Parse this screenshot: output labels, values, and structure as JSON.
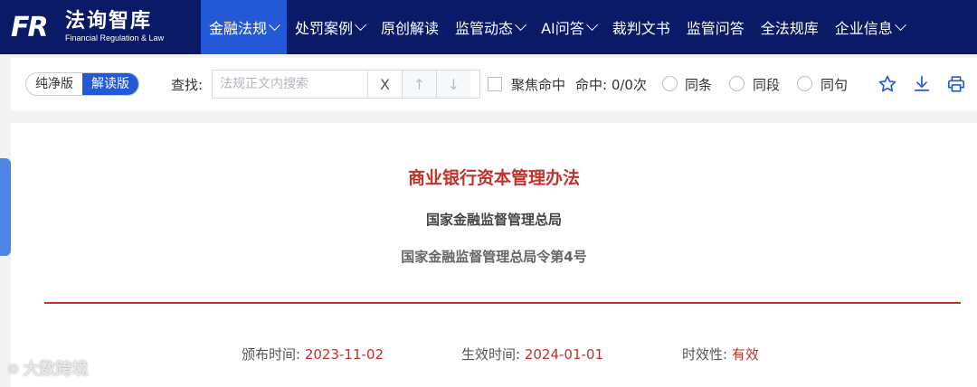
{
  "header": {
    "logo_mark": "FR",
    "logo_name": "法询智库",
    "logo_tagline": "Financial Regulation & Law",
    "nav": [
      {
        "label": "金融法规",
        "caret": true,
        "active": true
      },
      {
        "label": "处罚案例",
        "caret": true
      },
      {
        "label": "原创解读",
        "caret": false
      },
      {
        "label": "监管动态",
        "caret": true
      },
      {
        "label": "AI问答",
        "caret": true
      },
      {
        "label": "裁判文书",
        "caret": false
      },
      {
        "label": "监管问答",
        "caret": false
      },
      {
        "label": "全法规库",
        "caret": false
      },
      {
        "label": "企业信息",
        "caret": true
      }
    ]
  },
  "toolbar": {
    "version_plain": "纯净版",
    "version_interpret": "解读版",
    "active_version": "解读版",
    "find_label": "查找:",
    "search_placeholder": "法规正文内搜索",
    "clear_glyph": "X",
    "up_glyph": "↑",
    "down_glyph": "↓",
    "focus_label": "聚焦命中",
    "hit_label": "命中: 0/0次",
    "radio_same_clause": "同条",
    "radio_same_paragraph": "同段",
    "radio_same_sentence": "同句",
    "icons": [
      "star-icon",
      "download-icon",
      "print-icon"
    ]
  },
  "document": {
    "title": "商业银行资本管理办法",
    "issuer": "国家金融监督管理总局",
    "order_number": "国家金融监督管理总局令第4号",
    "promulgated_label": "颁布时间:",
    "promulgated_value": "2023-11-02",
    "effective_label": "生效时间:",
    "effective_value": "2024-01-01",
    "validity_label": "时效性:",
    "validity_value": "有效"
  },
  "watermark": {
    "text": "大数跨境"
  },
  "colors": {
    "nav_bg": "#0b1a66",
    "nav_active": "#2358d6",
    "title_red": "#c0322b",
    "accent_blue": "#2358d6"
  }
}
